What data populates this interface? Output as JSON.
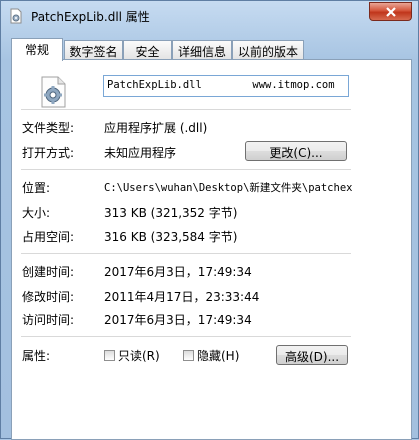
{
  "window": {
    "title": "PatchExpLib.dll 属性"
  },
  "tabs": [
    {
      "label": "常规",
      "active": true
    },
    {
      "label": "数字签名",
      "active": false
    },
    {
      "label": "安全",
      "active": false
    },
    {
      "label": "详细信息",
      "active": false
    },
    {
      "label": "以前的版本",
      "active": false
    }
  ],
  "general": {
    "file_name": "PatchExpLib.dll        www.itmop.com",
    "file_type_label": "文件类型:",
    "file_type_value": "应用程序扩展 (.dll)",
    "open_with_label": "打开方式:",
    "open_with_value": "未知应用程序",
    "change_button": "更改(C)...",
    "location_label": "位置:",
    "location_value": "C:\\Users\\wuhan\\Desktop\\新建文件夹\\patchex",
    "size_label": "大小:",
    "size_value": "313 KB (321,352 字节)",
    "disk_size_label": "占用空间:",
    "disk_size_value": "316 KB (323,584 字节)",
    "created_label": "创建时间:",
    "created_value": "2017年6月3日，17:49:34",
    "modified_label": "修改时间:",
    "modified_value": "2011年4月17日，23:33:44",
    "accessed_label": "访问时间:",
    "accessed_value": "2017年6月3日，17:49:34",
    "attributes_label": "属性:",
    "readonly_label": "只读(R)",
    "readonly_checked": false,
    "hidden_label": "隐藏(H)",
    "hidden_checked": false,
    "advanced_button": "高级(D)..."
  },
  "icons": {
    "title": "dll-file-icon",
    "file": "dll-file-gear-icon",
    "close": "close-icon"
  },
  "colors": {
    "close_button": "#c9442a",
    "tab_border": "#8aa0b8",
    "input_border": "#7aa7d6"
  }
}
